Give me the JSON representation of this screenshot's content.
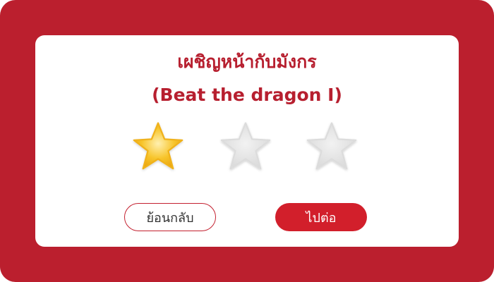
{
  "dialog": {
    "title_thai": "เผชิญหน้ากับมังกร",
    "title_english": "(Beat the dragon I)"
  },
  "rating": {
    "earned": 1,
    "total": 3,
    "filled_color": "#f5b820",
    "empty_color": "#e3e3e3"
  },
  "buttons": {
    "back_label": "ย้อนกลับ",
    "next_label": "ไปต่อ"
  },
  "colors": {
    "brand_red": "#bb1f2e",
    "title_red": "#b71f2f",
    "button_red": "#d21f2b"
  }
}
